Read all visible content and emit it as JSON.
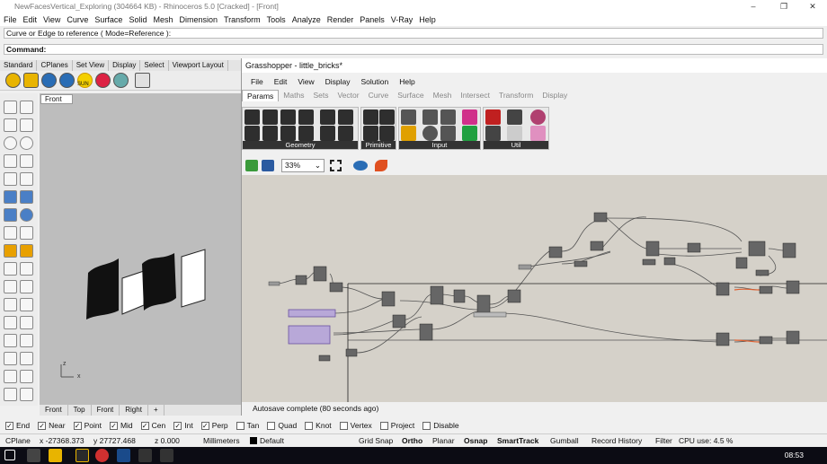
{
  "window": {
    "title": "NewFacesVertical_Exploring (304664 KB) - Rhinoceros 5.0 [Cracked] - [Front]",
    "minimize": "–",
    "restore": "❐",
    "close": "✕"
  },
  "menu": [
    "File",
    "Edit",
    "View",
    "Curve",
    "Surface",
    "Solid",
    "Mesh",
    "Dimension",
    "Transform",
    "Tools",
    "Analyze",
    "Render",
    "Panels",
    "V-Ray",
    "Help"
  ],
  "command": {
    "prompt": "Curve or Edge to reference ( Mode=Reference ):",
    "label": "Command:"
  },
  "toolbar_tabs": [
    "Standard",
    "CPlanes",
    "Set View",
    "Display",
    "Select",
    "Viewport Layout"
  ],
  "toolbar_icons": [
    "m-icon",
    "lasso-icon",
    "r-icon",
    "rt-icon",
    "sun-icon",
    "vray-icon",
    "render-icon",
    "grid-icon"
  ],
  "toolbar_sun_label": "SUN",
  "viewport": {
    "name": "Front",
    "tabs": [
      "Front",
      "Top",
      "Front",
      "Right"
    ],
    "add_tab": "+",
    "axis_z": "z",
    "axis_x": "x"
  },
  "grasshopper": {
    "title": "Grasshopper - little_bricks*",
    "menu": [
      "File",
      "Edit",
      "View",
      "Display",
      "Solution",
      "Help"
    ],
    "tabs": [
      "Params",
      "Maths",
      "Sets",
      "Vector",
      "Curve",
      "Surface",
      "Mesh",
      "Intersect",
      "Transform",
      "Display"
    ],
    "active_tab": "Params",
    "groups": [
      "Geometry",
      "Primitive",
      "Input",
      "Util"
    ],
    "zoom": "33%",
    "status": "Autosave complete (80 seconds ago)"
  },
  "osnaps": [
    {
      "label": "End",
      "checked": true
    },
    {
      "label": "Near",
      "checked": true
    },
    {
      "label": "Point",
      "checked": true
    },
    {
      "label": "Mid",
      "checked": true
    },
    {
      "label": "Cen",
      "checked": true
    },
    {
      "label": "Int",
      "checked": true
    },
    {
      "label": "Perp",
      "checked": true
    },
    {
      "label": "Tan",
      "checked": false
    },
    {
      "label": "Quad",
      "checked": false
    },
    {
      "label": "Knot",
      "checked": false
    },
    {
      "label": "Vertex",
      "checked": false
    },
    {
      "label": "Project",
      "checked": false
    },
    {
      "label": "Disable",
      "checked": false
    }
  ],
  "statusbar": {
    "cplane": "CPlane",
    "x": "x -27368.373",
    "y": "y 27727.468",
    "z": "z 0.000",
    "units": "Millimeters",
    "layer": "Default",
    "grid_snap": "Grid Snap",
    "ortho": "Ortho",
    "planar": "Planar",
    "osnap": "Osnap",
    "smarttrack": "SmartTrack",
    "gumball": "Gumball",
    "record_history": "Record History",
    "filter": "Filter",
    "cpu": "CPU use: 4.5 %"
  },
  "taskbar": {
    "clock": "08:53"
  }
}
